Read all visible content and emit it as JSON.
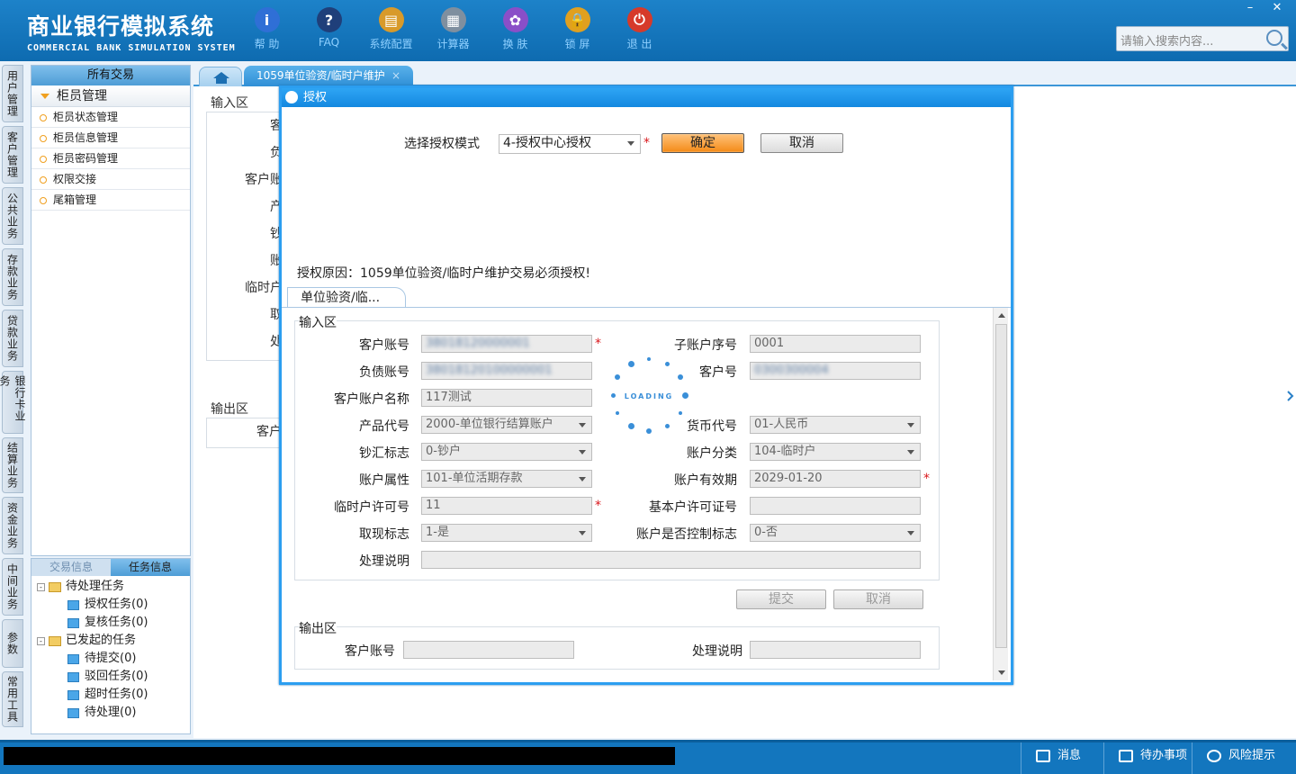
{
  "header": {
    "title_cn": "商业银行模拟系统",
    "title_en": "COMMERCIAL BANK SIMULATION SYSTEM",
    "toolbar": [
      {
        "label": "帮 助",
        "icon": "info-icon",
        "color": "#2f6fd6",
        "glyph": "i"
      },
      {
        "label": "FAQ",
        "icon": "faq-icon",
        "color": "#1f3f7a",
        "glyph": "?"
      },
      {
        "label": "系统配置",
        "icon": "config-icon",
        "color": "#d89a2a",
        "glyph": "▤"
      },
      {
        "label": "计算器",
        "icon": "calculator-icon",
        "color": "#7f8f9f",
        "glyph": "▦"
      },
      {
        "label": "换 肤",
        "icon": "skin-icon",
        "color": "#8a4fc8",
        "glyph": "✿"
      },
      {
        "label": "锁 屏",
        "icon": "lock-icon",
        "color": "#e0a020",
        "glyph": "🔒"
      },
      {
        "label": "退 出",
        "icon": "power-icon",
        "color": "#d63a2a",
        "glyph": "⏻"
      }
    ],
    "search_placeholder": "请输入搜索内容...",
    "window_controls": [
      "–",
      "✕"
    ]
  },
  "vtabs": [
    "用户管理",
    "客户管理",
    "公共业务",
    "存款业务",
    "贷款业务",
    "银行卡业务",
    "结算业务",
    "资金业务",
    "中间业务",
    "参数",
    "常用工具"
  ],
  "menu": {
    "header": "所有交易",
    "group": "柜员管理",
    "items": [
      "柜员状态管理",
      "柜员信息管理",
      "柜员密码管理",
      "权限交接",
      "尾箱管理"
    ]
  },
  "task_panel": {
    "tabs": [
      "交易信息",
      "任务信息"
    ],
    "tree": [
      {
        "label": "待处理任务",
        "level": 0
      },
      {
        "label": "授权任务(0)",
        "level": 1
      },
      {
        "label": "复核任务(0)",
        "level": 1
      },
      {
        "label": "已发起的任务",
        "level": 0
      },
      {
        "label": "待提交(0)",
        "level": 1
      },
      {
        "label": "驳回任务(0)",
        "level": 1
      },
      {
        "label": "超时任务(0)",
        "level": 1
      },
      {
        "label": "待处理(0)",
        "level": 1
      }
    ]
  },
  "main": {
    "active_tab": "1059单位验资/临时户维护",
    "tab_close": "×",
    "bg_input_title": "输入区",
    "bg_output_title": "输出区",
    "bg_labels": [
      "客",
      "负",
      "客户账",
      "产",
      "钞",
      "账",
      "临时户",
      "取",
      "处"
    ],
    "bg_output_label": "客户"
  },
  "dialog": {
    "title": "授权",
    "mode_label": "选择授权模式",
    "mode_value": "4-授权中心授权",
    "confirm": "确定",
    "cancel": "取消",
    "reason": "授权原因：1059单位验资/临时户维护交易必须授权!",
    "subtab": "单位验资/临...",
    "input_title": "输入区",
    "output_title": "输出区",
    "fields": {
      "cust_acct_label": "客户账号",
      "cust_acct_value": "38018120000001",
      "sub_seq_label": "子账户序号",
      "sub_seq_value": "0001",
      "debt_acct_label": "负债账号",
      "debt_acct_value": "38018120100000001",
      "cust_no_label": "客户号",
      "cust_no_value": "0300300004",
      "acct_name_label": "客户账户名称",
      "acct_name_value": "117测试",
      "product_label": "产品代号",
      "product_value": "2000-单位银行结算账户",
      "currency_label": "货币代号",
      "currency_value": "01-人民币",
      "cash_label": "钞汇标志",
      "cash_value": "0-钞户",
      "acct_class_label": "账户分类",
      "acct_class_value": "104-临时户",
      "acct_attr_label": "账户属性",
      "acct_attr_value": "101-单位活期存款",
      "valid_label": "账户有效期",
      "valid_value": "2029-01-20",
      "temp_permit_label": "临时户许可号",
      "temp_permit_value": "11",
      "basic_permit_label": "基本户许可证号",
      "basic_permit_value": "",
      "withdraw_label": "取现标志",
      "withdraw_value": "1-是",
      "control_label": "账户是否控制标志",
      "control_value": "0-否",
      "remark_label": "处理说明",
      "remark_value": ""
    },
    "submit": "提交",
    "cancel2": "取消",
    "out_acct_label": "客户账号",
    "out_acct_value": "",
    "out_remark_label": "处理说明",
    "out_remark_value": "",
    "loading_text": "LOADING"
  },
  "statusbar": {
    "items": [
      {
        "label": "消息",
        "icon": "mail-icon"
      },
      {
        "label": "待办事项",
        "icon": "checkbox-icon"
      },
      {
        "label": "风险提示",
        "icon": "chat-icon"
      }
    ]
  }
}
